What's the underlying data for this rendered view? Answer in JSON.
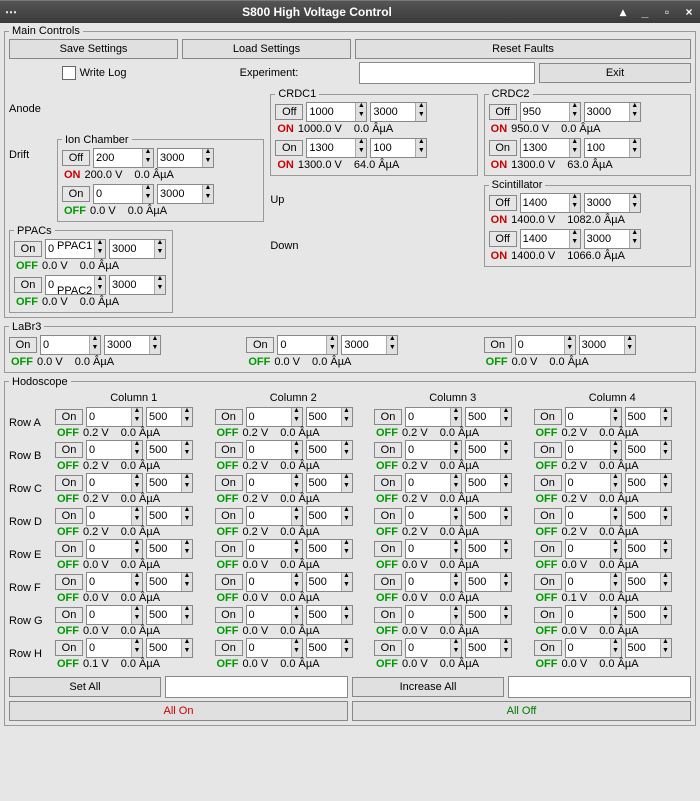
{
  "title": "S800 High Voltage Control",
  "groups": {
    "main": "Main Controls",
    "crdc1": "CRDC1",
    "crdc2": "CRDC2",
    "ion": "Ion Chamber",
    "scint": "Scintillator",
    "ppac": "PPACs",
    "labr": "LaBr3",
    "hodo": "Hodoscope"
  },
  "buttons": {
    "save": "Save Settings",
    "load": "Load Settings",
    "reset": "Reset Faults",
    "exit": "Exit",
    "setall": "Set All",
    "incall": "Increase All",
    "allon": "All On",
    "alloff": "All Off"
  },
  "labels": {
    "writelog": "Write Log",
    "experiment": "Experiment:",
    "anode": "Anode",
    "drift": "Drift",
    "up": "Up",
    "down": "Down",
    "ppac1": "PPAC1",
    "ppac2": "PPAC2",
    "rowA": "Row A",
    "rowB": "Row B",
    "rowC": "Row C",
    "rowD": "Row D",
    "rowE": "Row E",
    "rowF": "Row F",
    "rowG": "Row G",
    "rowH": "Row H",
    "col1": "Column 1",
    "col2": "Column 2",
    "col3": "Column 3",
    "col4": "Column 4"
  },
  "units": {
    "v": "V",
    "ua": "ÂµA"
  },
  "ch": {
    "crdc1_anode": {
      "btn": "Off",
      "setV": "1000",
      "ramp": "3000",
      "state": "ON",
      "rV": "1000.0",
      "rI": "0.0"
    },
    "crdc1_drift": {
      "btn": "On",
      "setV": "1300",
      "ramp": "100",
      "state": "ON",
      "rV": "1300.0",
      "rI": "64.0"
    },
    "crdc2_anode": {
      "btn": "Off",
      "setV": "950",
      "ramp": "3000",
      "state": "ON",
      "rV": "950.0",
      "rI": "0.0"
    },
    "crdc2_drift": {
      "btn": "On",
      "setV": "1300",
      "ramp": "100",
      "state": "ON",
      "rV": "1300.0",
      "rI": "63.0"
    },
    "ion_anode": {
      "btn": "Off",
      "setV": "200",
      "ramp": "3000",
      "state": "ON",
      "rV": "200.0",
      "rI": "0.0"
    },
    "ion_drift": {
      "btn": "On",
      "setV": "0",
      "ramp": "3000",
      "state": "OFF",
      "rV": "0.0",
      "rI": "0.0"
    },
    "scint_up": {
      "btn": "Off",
      "setV": "1400",
      "ramp": "3000",
      "state": "ON",
      "rV": "1400.0",
      "rI": "1082.0"
    },
    "scint_down": {
      "btn": "Off",
      "setV": "1400",
      "ramp": "3000",
      "state": "ON",
      "rV": "1400.0",
      "rI": "1066.0"
    },
    "ppac1": {
      "btn": "On",
      "setV": "0",
      "ramp": "3000",
      "state": "OFF",
      "rV": "0.0",
      "rI": "0.0"
    },
    "ppac2": {
      "btn": "On",
      "setV": "0",
      "ramp": "3000",
      "state": "OFF",
      "rV": "0.0",
      "rI": "0.0"
    },
    "labr1": {
      "btn": "On",
      "setV": "0",
      "ramp": "3000",
      "state": "OFF",
      "rV": "0.0",
      "rI": "0.0"
    },
    "labr2": {
      "btn": "On",
      "setV": "0",
      "ramp": "3000",
      "state": "OFF",
      "rV": "0.0",
      "rI": "0.0"
    },
    "labr3": {
      "btn": "On",
      "setV": "0",
      "ramp": "3000",
      "state": "OFF",
      "rV": "0.0",
      "rI": "0.0"
    }
  },
  "hodo": {
    "A": [
      {
        "rV": "0.2",
        "rI": "0.0"
      },
      {
        "rV": "0.2",
        "rI": "0.0"
      },
      {
        "rV": "0.2",
        "rI": "0.0"
      },
      {
        "rV": "0.2",
        "rI": "0.0"
      }
    ],
    "B": [
      {
        "rV": "0.2",
        "rI": "0.0"
      },
      {
        "rV": "0.2",
        "rI": "0.0"
      },
      {
        "rV": "0.2",
        "rI": "0.0"
      },
      {
        "rV": "0.2",
        "rI": "0.0"
      }
    ],
    "C": [
      {
        "rV": "0.2",
        "rI": "0.0"
      },
      {
        "rV": "0.2",
        "rI": "0.0"
      },
      {
        "rV": "0.2",
        "rI": "0.0"
      },
      {
        "rV": "0.2",
        "rI": "0.0"
      }
    ],
    "D": [
      {
        "rV": "0.2",
        "rI": "0.0"
      },
      {
        "rV": "0.2",
        "rI": "0.0"
      },
      {
        "rV": "0.2",
        "rI": "0.0"
      },
      {
        "rV": "0.2",
        "rI": "0.0"
      }
    ],
    "E": [
      {
        "rV": "0.0",
        "rI": "0.0"
      },
      {
        "rV": "0.0",
        "rI": "0.0"
      },
      {
        "rV": "0.0",
        "rI": "0.0"
      },
      {
        "rV": "0.0",
        "rI": "0.0"
      }
    ],
    "F": [
      {
        "rV": "0.0",
        "rI": "0.0"
      },
      {
        "rV": "0.0",
        "rI": "0.0"
      },
      {
        "rV": "0.0",
        "rI": "0.0"
      },
      {
        "rV": "0.1",
        "rI": "0.0"
      }
    ],
    "G": [
      {
        "rV": "0.0",
        "rI": "0.0"
      },
      {
        "rV": "0.0",
        "rI": "0.0"
      },
      {
        "rV": "0.0",
        "rI": "0.0"
      },
      {
        "rV": "0.0",
        "rI": "0.0"
      }
    ],
    "H": [
      {
        "rV": "0.1",
        "rI": "0.0"
      },
      {
        "rV": "0.0",
        "rI": "0.0"
      },
      {
        "rV": "0.0",
        "rI": "0.0"
      },
      {
        "rV": "0.0",
        "rI": "0.0"
      }
    ]
  },
  "hodoDefaults": {
    "btn": "On",
    "setV": "0",
    "ramp": "500",
    "state": "OFF"
  }
}
